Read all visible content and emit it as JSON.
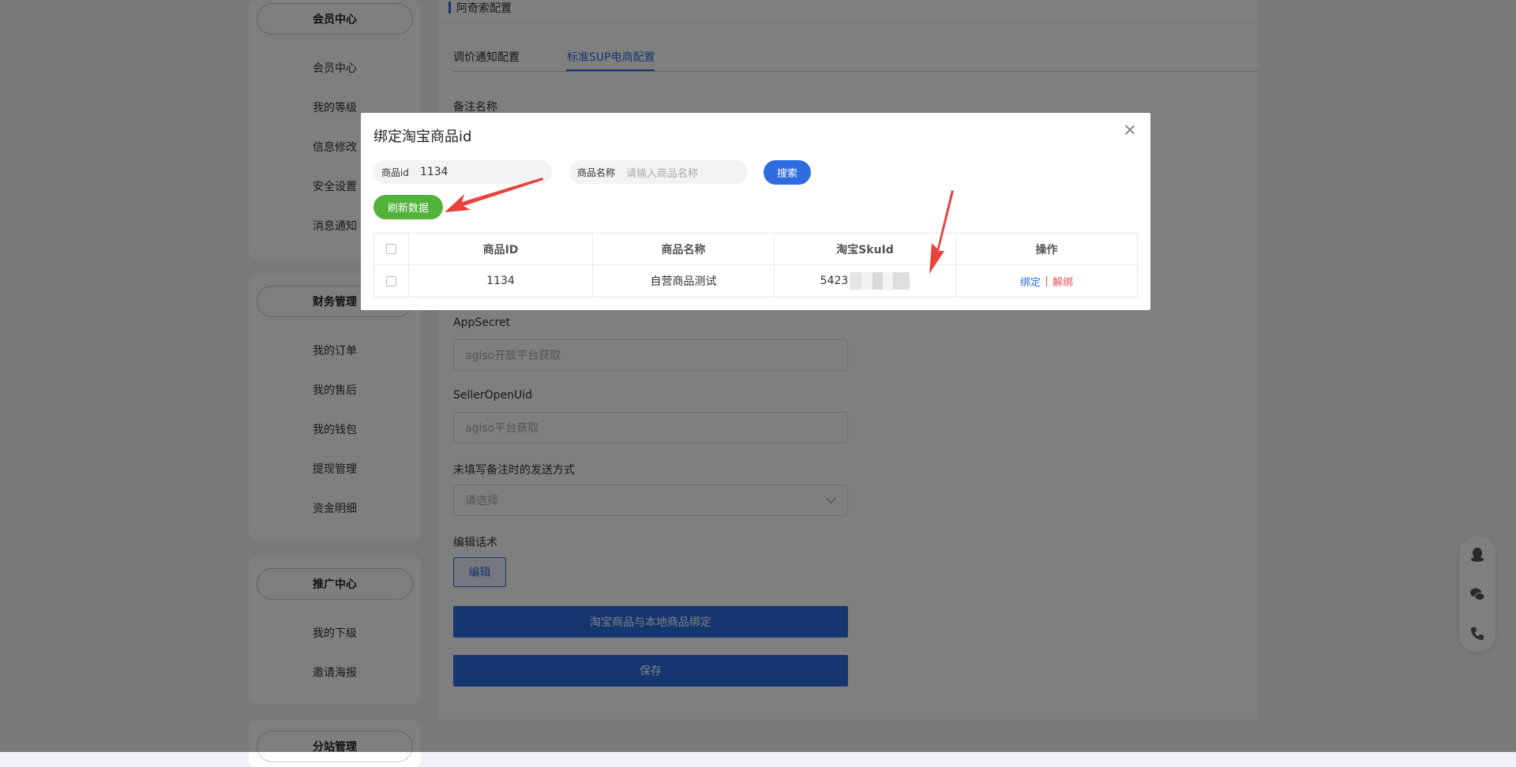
{
  "sidebar": {
    "sections": [
      {
        "title": "会员中心",
        "items": [
          "会员中心",
          "我的等级",
          "信息修改",
          "安全设置",
          "消息通知"
        ]
      },
      {
        "title": "财务管理",
        "items": [
          "我的订单",
          "我的售后",
          "我的钱包",
          "提现管理",
          "资金明细"
        ]
      },
      {
        "title": "推广中心",
        "items": [
          "我的下级",
          "邀请海报"
        ]
      },
      {
        "title": "分站管理",
        "items": []
      }
    ]
  },
  "main": {
    "title": "阿奇索配置",
    "tabs": [
      {
        "label": "调价通知配置",
        "active": false
      },
      {
        "label": "标准SUP电商配置",
        "active": true
      }
    ],
    "form": {
      "remark_label": "备注名称",
      "appsecret_label": "AppSecret",
      "appsecret_placeholder": "agiso开放平台获取",
      "seller_label": "SellerOpenUid",
      "seller_placeholder": "agiso平台获取",
      "send_mode_label": "未填写备注时的发送方式",
      "send_mode_placeholder": "请选择",
      "script_label": "编辑话术",
      "edit_button": "编辑",
      "bind_button": "淘宝商品与本地商品绑定",
      "save_button": "保存"
    }
  },
  "dialog": {
    "title": "绑定淘宝商品id",
    "search": {
      "id_label": "商品id",
      "id_value": "1134",
      "name_label": "商品名称",
      "name_placeholder": "请输入商品名称",
      "search_button": "搜索",
      "refresh_button": "刷新数据"
    },
    "table": {
      "headers": [
        "商品ID",
        "商品名称",
        "淘宝SkuId",
        "操作"
      ],
      "rows": [
        {
          "id": "1134",
          "name": "自营商品测试",
          "sku_prefix": "5423",
          "bind": "绑定",
          "unbind": "解绑"
        }
      ]
    }
  },
  "colors": {
    "primary": "#2d6de0",
    "green": "#52b33a",
    "danger": "#e85050",
    "annotation": "#e8423a"
  }
}
